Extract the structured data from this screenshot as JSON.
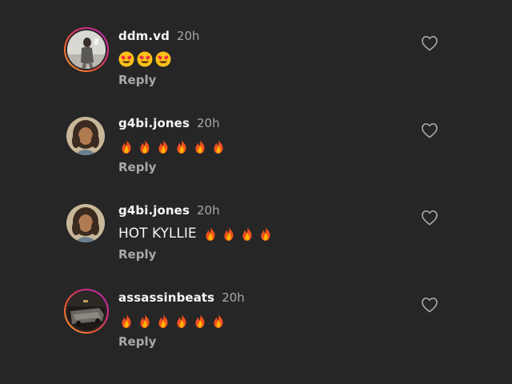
{
  "comments": [
    {
      "username": "ddm.vd",
      "time": "20h",
      "text": "",
      "emojis": [
        "heart-eyes",
        "heart-eyes",
        "heart-eyes"
      ],
      "reply_label": "Reply",
      "avatar": "avatar-photo-ddm",
      "story_ring": true
    },
    {
      "username": "g4bi.jones",
      "time": "20h",
      "text": "",
      "emojis": [
        "fire",
        "fire",
        "fire",
        "fire",
        "fire",
        "fire"
      ],
      "reply_label": "Reply",
      "avatar": "avatar-photo-g4bi",
      "story_ring": false
    },
    {
      "username": "g4bi.jones",
      "time": "20h",
      "text": "HOT KYLLIE",
      "emojis": [
        "fire",
        "fire",
        "fire",
        "fire"
      ],
      "reply_label": "Reply",
      "avatar": "avatar-photo-g4bi",
      "story_ring": false
    },
    {
      "username": "assassinbeats",
      "time": "20h",
      "text": "",
      "emojis": [
        "fire",
        "fire",
        "fire",
        "fire",
        "fire",
        "fire"
      ],
      "reply_label": "Reply",
      "avatar": "avatar-photo-assassinbeats",
      "story_ring": true
    }
  ],
  "colors": {
    "background": "#262626",
    "primary_text": "#f5f5f5",
    "secondary_text": "#a8a8a8",
    "story_ring_start": "#f9a13a",
    "story_ring_end": "#b72cc0"
  },
  "icons": {
    "like": "heart-outline-icon",
    "fire": "fire-emoji",
    "heart_eyes": "heart-eyes-emoji"
  }
}
